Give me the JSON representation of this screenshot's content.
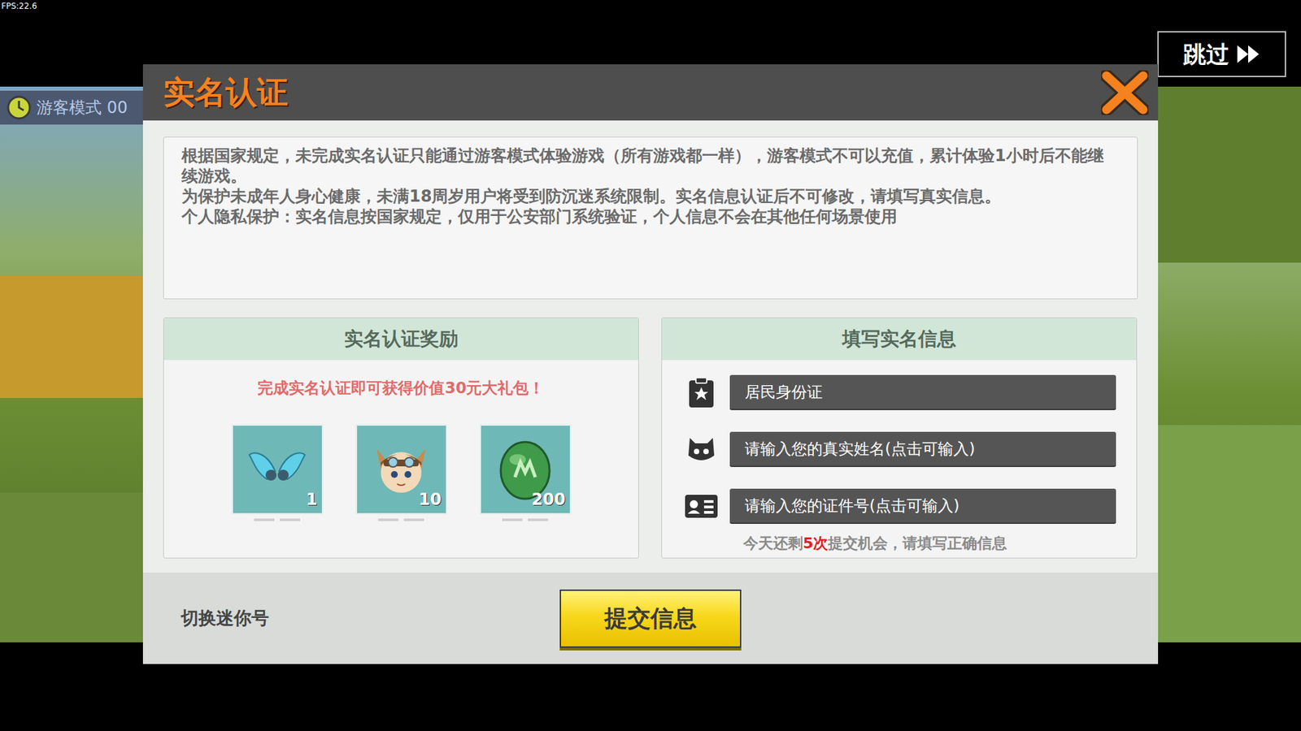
{
  "fps": "FPS:22.6",
  "guest_timer": "游客模式 00",
  "skip_button": {
    "label": "跳过"
  },
  "dialog": {
    "title": "实名认证"
  },
  "notice": [
    "根据国家规定，未完成实名认证只能通过游客模式体验游戏（所有游戏都一样），游客模式不可以充值，累计体验1小时后不能继续游戏。",
    "为保护未成年人身心健康，未满18周岁用户将受到防沉迷系统限制。实名信息认证后不可修改，请填写真实信息。",
    "个人隐私保护：实名信息按国家规定，仅用于公安部门系统验证，个人信息不会在其他任何场景使用"
  ],
  "rewards": {
    "title": "实名认证奖励",
    "subtitle": "完成实名认证即可获得价值30元大礼包！",
    "items": [
      {
        "kind": "wings",
        "count": "1"
      },
      {
        "kind": "avatar",
        "count": "10"
      },
      {
        "kind": "egg",
        "count": "200"
      }
    ]
  },
  "form": {
    "title": "填写实名信息",
    "fields": [
      {
        "kind": "select",
        "text": "居民身份证"
      },
      {
        "kind": "input",
        "text": "请输入您的真实姓名(点击可输入)"
      },
      {
        "kind": "input",
        "text": "请输入您的证件号(点击可输入)"
      }
    ],
    "attempts": {
      "prefix": "今天还剩",
      "count": "5次",
      "suffix": "提交机会，请填写正确信息"
    }
  },
  "switch_account": "切换迷你号",
  "submit": "提交信息"
}
